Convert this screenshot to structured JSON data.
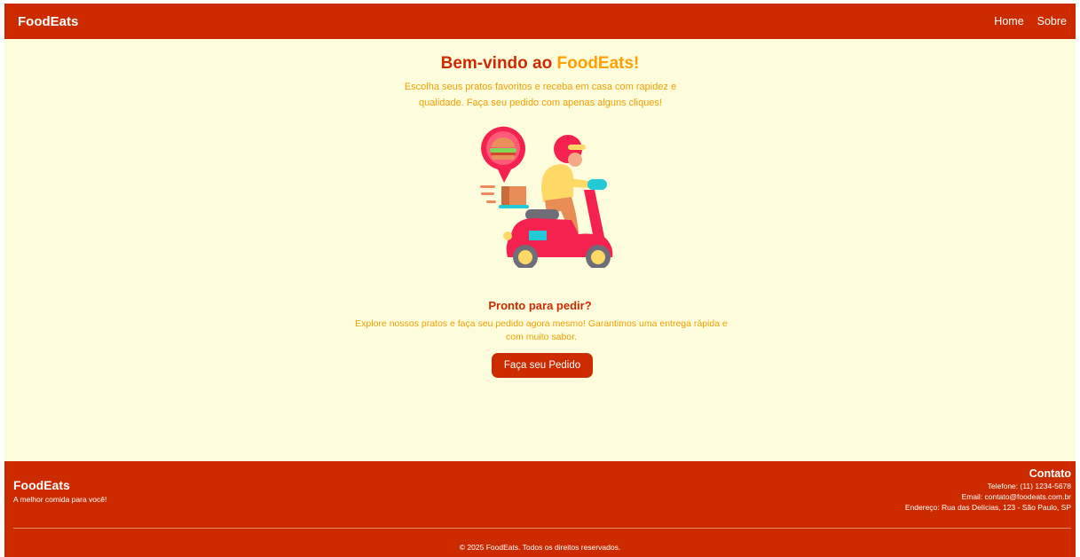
{
  "header": {
    "brand": "FoodEats",
    "nav": [
      {
        "label": "Home"
      },
      {
        "label": "Sobre"
      }
    ]
  },
  "hero": {
    "title_prefix": "Bem-vindo ao ",
    "title_accent": "FoodEats!",
    "subtitle": "Escolha seus pratos favoritos e receba em casa com rapidez e qualidade. Faça seu pedido com apenas alguns cliques!",
    "illustration_icon": "delivery-scooter-icon"
  },
  "cta": {
    "title": "Pronto para pedir?",
    "text": "Explore nossos pratos e faça seu pedido agora mesmo! Garantimos uma entrega rápida e com muito sabor.",
    "button_label": "Faça seu Pedido"
  },
  "footer": {
    "brand": "FoodEats",
    "tagline": "A melhor comida para você!",
    "contact": {
      "title": "Contato",
      "phone": "Telefone: (11) 1234-5678",
      "email": "Email: contato@foodeats.com.br",
      "address": "Endereço: Rua das Delícias, 123 - São Paulo, SP"
    },
    "copyright": "© 2025 FoodEats. Todos os direitos reservados."
  },
  "colors": {
    "primary": "#cc2b00",
    "accent": "#ff9f00",
    "background": "#fdfdde"
  }
}
